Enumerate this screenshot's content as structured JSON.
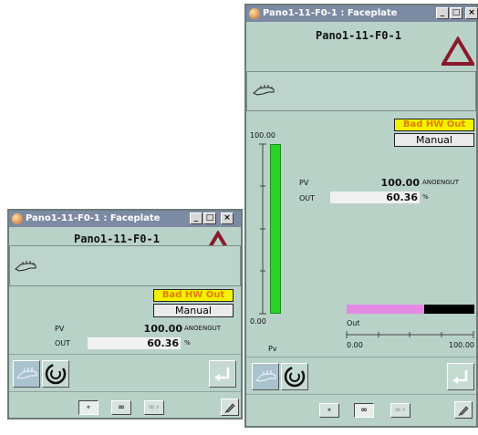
{
  "colors": {
    "window_bg": "#b8d2c8",
    "titlebar": "#7d8aa3",
    "alarm_triangle": "#8a1a2a",
    "bad_hw_bg": "#f2f100",
    "bad_hw_text": "#e08000",
    "pv_bar": "#28d428",
    "out_bar": "#e48ae4"
  },
  "small_faceplate": {
    "window_title": "Pano1-11-F0-1 : Faceplate",
    "tag_name": "Pano1-11-F0-1",
    "status_badge": "Bad HW Out",
    "mode_label": "Manual",
    "pv_label": "PV",
    "pv_value": "100.00",
    "pv_unit": "ANOENGUT",
    "out_label": "OUT",
    "out_value": "60.36",
    "out_unit": "%",
    "window_buttons": [
      "_",
      "□",
      "×"
    ],
    "bottom_buttons": [
      "∘",
      "∞",
      "∞∘"
    ],
    "icons": [
      "faceplate-app-icon",
      "alarm-triangle-icon",
      "hand-icon",
      "hand-disabled-icon",
      "swirl-icon",
      "enter-icon",
      "pin-icon"
    ]
  },
  "large_faceplate": {
    "window_title": "Pano1-11-F0-1 : Faceplate",
    "tag_name": "Pano1-11-F0-1",
    "status_badge": "Bad HW Out",
    "mode_label": "Manual",
    "pv_label": "PV",
    "pv_value": "100.00",
    "pv_unit": "ANOENGUT",
    "out_label": "OUT",
    "out_value": "60.36",
    "out_unit": "%",
    "bar_scale_top": "100.00",
    "bar_scale_bottom": "0.00",
    "bar_caption": "Pv",
    "pv_level_fraction": 1.0,
    "out_bar_caption": "Out",
    "out_scale_min": "0.00",
    "out_scale_max": "100.00",
    "out_level_fraction": 0.6036,
    "window_buttons": [
      "_",
      "□",
      "×"
    ],
    "bottom_buttons": [
      "∘",
      "∞",
      "∞∘"
    ],
    "icons": [
      "faceplate-app-icon",
      "alarm-triangle-icon",
      "hand-icon",
      "hand-disabled-icon",
      "swirl-icon",
      "enter-icon",
      "pin-icon"
    ]
  }
}
